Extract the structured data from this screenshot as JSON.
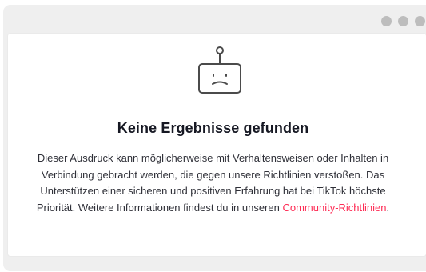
{
  "window": {
    "control_color": "#bdbdbd"
  },
  "empty_state": {
    "title": "Keine Ergebnisse gefunden",
    "message_prefix": "Dieser Ausdruck kann möglicherweise mit Verhaltensweisen oder Inhalten in Verbindung gebracht werden, die gegen unsere Richtlinien verstoßen. Das Unterstützen einer sicheren und positiven Erfahrung hat bei TikTok höchste Priorität. Weitere Informationen findest du in unseren ",
    "link_text": "Community-Richtlinien",
    "message_suffix": ".",
    "accent_color": "#fe2c55",
    "icon": "sad-robot-icon"
  }
}
